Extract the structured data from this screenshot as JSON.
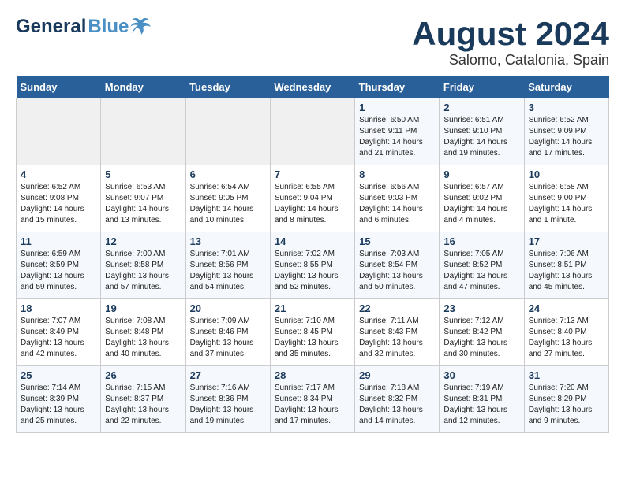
{
  "header": {
    "logo_general": "General",
    "logo_blue": "Blue",
    "month_title": "August 2024",
    "location": "Salomo, Catalonia, Spain"
  },
  "calendar": {
    "weekdays": [
      "Sunday",
      "Monday",
      "Tuesday",
      "Wednesday",
      "Thursday",
      "Friday",
      "Saturday"
    ],
    "weeks": [
      [
        {
          "day": "",
          "content": ""
        },
        {
          "day": "",
          "content": ""
        },
        {
          "day": "",
          "content": ""
        },
        {
          "day": "",
          "content": ""
        },
        {
          "day": "1",
          "content": "Sunrise: 6:50 AM\nSunset: 9:11 PM\nDaylight: 14 hours\nand 21 minutes."
        },
        {
          "day": "2",
          "content": "Sunrise: 6:51 AM\nSunset: 9:10 PM\nDaylight: 14 hours\nand 19 minutes."
        },
        {
          "day": "3",
          "content": "Sunrise: 6:52 AM\nSunset: 9:09 PM\nDaylight: 14 hours\nand 17 minutes."
        }
      ],
      [
        {
          "day": "4",
          "content": "Sunrise: 6:52 AM\nSunset: 9:08 PM\nDaylight: 14 hours\nand 15 minutes."
        },
        {
          "day": "5",
          "content": "Sunrise: 6:53 AM\nSunset: 9:07 PM\nDaylight: 14 hours\nand 13 minutes."
        },
        {
          "day": "6",
          "content": "Sunrise: 6:54 AM\nSunset: 9:05 PM\nDaylight: 14 hours\nand 10 minutes."
        },
        {
          "day": "7",
          "content": "Sunrise: 6:55 AM\nSunset: 9:04 PM\nDaylight: 14 hours\nand 8 minutes."
        },
        {
          "day": "8",
          "content": "Sunrise: 6:56 AM\nSunset: 9:03 PM\nDaylight: 14 hours\nand 6 minutes."
        },
        {
          "day": "9",
          "content": "Sunrise: 6:57 AM\nSunset: 9:02 PM\nDaylight: 14 hours\nand 4 minutes."
        },
        {
          "day": "10",
          "content": "Sunrise: 6:58 AM\nSunset: 9:00 PM\nDaylight: 14 hours\nand 1 minute."
        }
      ],
      [
        {
          "day": "11",
          "content": "Sunrise: 6:59 AM\nSunset: 8:59 PM\nDaylight: 13 hours\nand 59 minutes."
        },
        {
          "day": "12",
          "content": "Sunrise: 7:00 AM\nSunset: 8:58 PM\nDaylight: 13 hours\nand 57 minutes."
        },
        {
          "day": "13",
          "content": "Sunrise: 7:01 AM\nSunset: 8:56 PM\nDaylight: 13 hours\nand 54 minutes."
        },
        {
          "day": "14",
          "content": "Sunrise: 7:02 AM\nSunset: 8:55 PM\nDaylight: 13 hours\nand 52 minutes."
        },
        {
          "day": "15",
          "content": "Sunrise: 7:03 AM\nSunset: 8:54 PM\nDaylight: 13 hours\nand 50 minutes."
        },
        {
          "day": "16",
          "content": "Sunrise: 7:05 AM\nSunset: 8:52 PM\nDaylight: 13 hours\nand 47 minutes."
        },
        {
          "day": "17",
          "content": "Sunrise: 7:06 AM\nSunset: 8:51 PM\nDaylight: 13 hours\nand 45 minutes."
        }
      ],
      [
        {
          "day": "18",
          "content": "Sunrise: 7:07 AM\nSunset: 8:49 PM\nDaylight: 13 hours\nand 42 minutes."
        },
        {
          "day": "19",
          "content": "Sunrise: 7:08 AM\nSunset: 8:48 PM\nDaylight: 13 hours\nand 40 minutes."
        },
        {
          "day": "20",
          "content": "Sunrise: 7:09 AM\nSunset: 8:46 PM\nDaylight: 13 hours\nand 37 minutes."
        },
        {
          "day": "21",
          "content": "Sunrise: 7:10 AM\nSunset: 8:45 PM\nDaylight: 13 hours\nand 35 minutes."
        },
        {
          "day": "22",
          "content": "Sunrise: 7:11 AM\nSunset: 8:43 PM\nDaylight: 13 hours\nand 32 minutes."
        },
        {
          "day": "23",
          "content": "Sunrise: 7:12 AM\nSunset: 8:42 PM\nDaylight: 13 hours\nand 30 minutes."
        },
        {
          "day": "24",
          "content": "Sunrise: 7:13 AM\nSunset: 8:40 PM\nDaylight: 13 hours\nand 27 minutes."
        }
      ],
      [
        {
          "day": "25",
          "content": "Sunrise: 7:14 AM\nSunset: 8:39 PM\nDaylight: 13 hours\nand 25 minutes."
        },
        {
          "day": "26",
          "content": "Sunrise: 7:15 AM\nSunset: 8:37 PM\nDaylight: 13 hours\nand 22 minutes."
        },
        {
          "day": "27",
          "content": "Sunrise: 7:16 AM\nSunset: 8:36 PM\nDaylight: 13 hours\nand 19 minutes."
        },
        {
          "day": "28",
          "content": "Sunrise: 7:17 AM\nSunset: 8:34 PM\nDaylight: 13 hours\nand 17 minutes."
        },
        {
          "day": "29",
          "content": "Sunrise: 7:18 AM\nSunset: 8:32 PM\nDaylight: 13 hours\nand 14 minutes."
        },
        {
          "day": "30",
          "content": "Sunrise: 7:19 AM\nSunset: 8:31 PM\nDaylight: 13 hours\nand 12 minutes."
        },
        {
          "day": "31",
          "content": "Sunrise: 7:20 AM\nSunset: 8:29 PM\nDaylight: 13 hours\nand 9 minutes."
        }
      ]
    ]
  }
}
